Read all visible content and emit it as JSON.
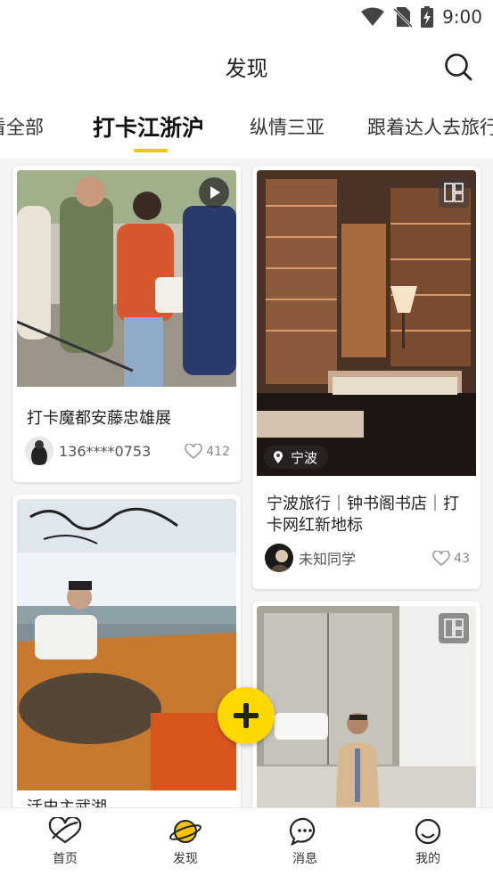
{
  "status_bar": {
    "time": "9:00",
    "icons": [
      "wifi-icon",
      "no-sim-icon",
      "battery-charging-icon"
    ]
  },
  "header": {
    "title": "发现",
    "search_icon": "search-icon"
  },
  "tabs": [
    {
      "label": "看全部"
    },
    {
      "label": "打卡江浙沪",
      "active": true
    },
    {
      "label": "纵情三亚"
    },
    {
      "label": "跟着达人去旅行"
    }
  ],
  "accent_color": "#f7c400",
  "feed": {
    "cards": [
      {
        "title": "打卡魔都安藤忠雄展",
        "author": "136****0753",
        "likes": "412",
        "badge": "play-icon"
      },
      {
        "title": "宁波旅行｜钟书阁书店｜打卡网红新地标",
        "author": "未知同学",
        "likes": "43",
        "location": "宁波",
        "badge": "grid-icon"
      },
      {
        "title": "活史主武湖",
        "badge": "none"
      },
      {
        "title": "",
        "badge": "grid-icon"
      }
    ]
  },
  "fab": {
    "icon": "plus-icon"
  },
  "bottom_nav": [
    {
      "label": "首页",
      "icon": "home-heart-icon"
    },
    {
      "label": "发现",
      "icon": "planet-icon",
      "active": true
    },
    {
      "label": "消息",
      "icon": "chat-bubble-icon"
    },
    {
      "label": "我的",
      "icon": "smiley-icon"
    }
  ]
}
